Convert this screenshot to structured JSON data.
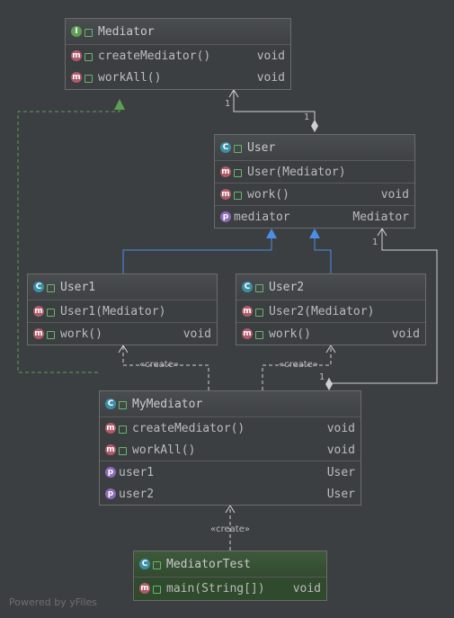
{
  "nodes": {
    "mediator": {
      "title": "Mediator",
      "kind": "I",
      "methods": [
        {
          "name": "createMediator()",
          "type": "void"
        },
        {
          "name": "workAll()",
          "type": "void"
        }
      ]
    },
    "user": {
      "title": "User",
      "kind": "C",
      "ctor": {
        "name": "User(Mediator)"
      },
      "methods": [
        {
          "name": "work()",
          "type": "void"
        }
      ],
      "fields": [
        {
          "name": "mediator",
          "type": "Mediator"
        }
      ]
    },
    "user1": {
      "title": "User1",
      "kind": "C",
      "ctor": {
        "name": "User1(Mediator)"
      },
      "methods": [
        {
          "name": "work()",
          "type": "void"
        }
      ]
    },
    "user2": {
      "title": "User2",
      "kind": "C",
      "ctor": {
        "name": "User2(Mediator)"
      },
      "methods": [
        {
          "name": "work()",
          "type": "void"
        }
      ]
    },
    "mymediator": {
      "title": "MyMediator",
      "kind": "C",
      "methods": [
        {
          "name": "createMediator()",
          "type": "void"
        },
        {
          "name": "workAll()",
          "type": "void"
        }
      ],
      "fields": [
        {
          "name": "user1",
          "type": "User"
        },
        {
          "name": "user2",
          "type": "User"
        }
      ]
    },
    "mediatortest": {
      "title": "MediatorTest",
      "kind": "C",
      "methods": [
        {
          "name": "main(String[])",
          "type": "void"
        }
      ]
    }
  },
  "edge_labels": {
    "mult_a": "1",
    "mult_b": "1",
    "mult_c": "1",
    "mult_d": "1",
    "create_1": "«create»",
    "create_2": "«create»",
    "create_3": "«create»"
  },
  "icons": {
    "interface": "I",
    "class": "C",
    "method": "m",
    "field": "p"
  },
  "footer": "Powered by yFiles"
}
